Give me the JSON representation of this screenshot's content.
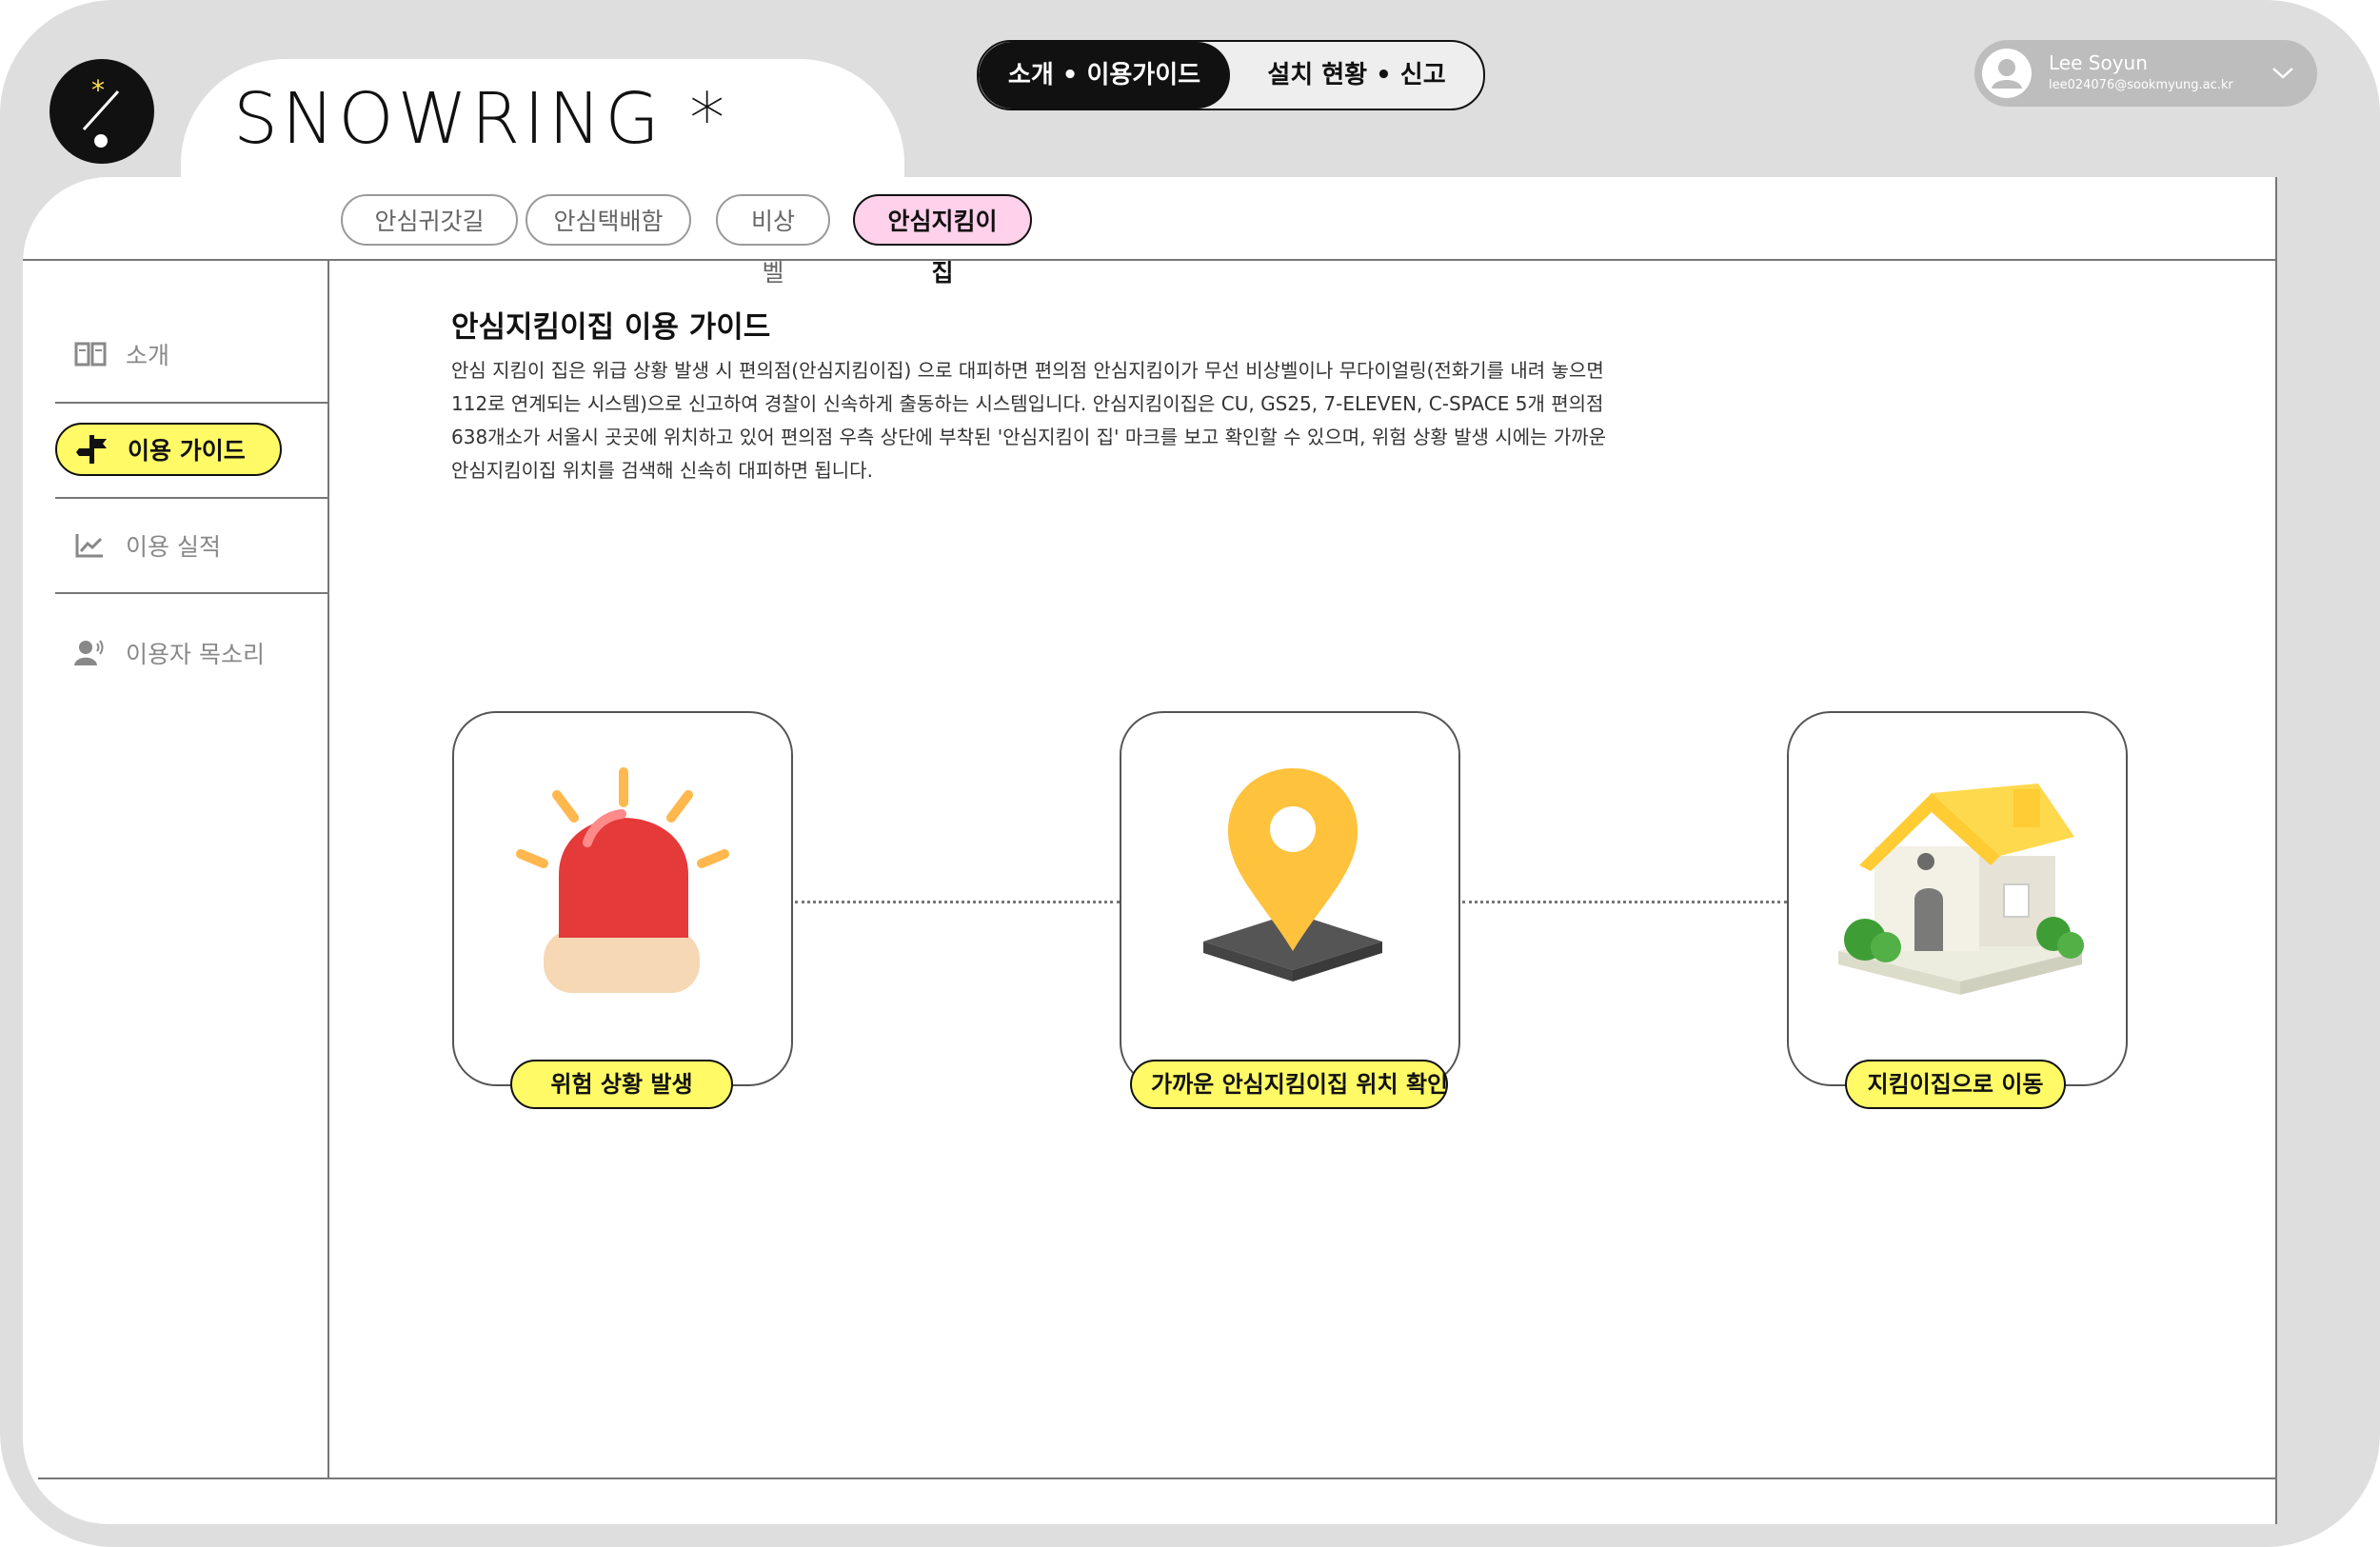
{
  "brand": {
    "wordmark": "SNOWRING *"
  },
  "topnav": {
    "active": "소개 • 이용가이드",
    "inactive": "설치 현황 • 신고"
  },
  "user": {
    "name": "Lee Soyun",
    "email": "lee024076@sookmyung.ac.kr"
  },
  "service_tabs": [
    {
      "label": "안심귀갓길",
      "active": false
    },
    {
      "label": "안심택배함",
      "active": false
    },
    {
      "label": "비상벨",
      "active": false
    },
    {
      "label": "안심지킴이집",
      "active": true
    }
  ],
  "sidebar": {
    "items": [
      {
        "label": "소개",
        "icon": "book-icon",
        "active": false
      },
      {
        "label": "이용 가이드",
        "icon": "signpost-icon",
        "active": true
      },
      {
        "label": "이용 실적",
        "icon": "chart-icon",
        "active": false
      },
      {
        "label": "이용자 목소리",
        "icon": "voice-icon",
        "active": false
      }
    ]
  },
  "main": {
    "title": "안심지킴이집 이용 가이드",
    "description": "안심 지킴이 집은 위급 상황 발생 시 편의점(안심지킴이집) 으로 대피하면 편의점 안심지킴이가 무선 비상벨이나 무다이얼링(전화기를 내려 놓으면 112로 연계되는 시스템)으로 신고하여 경찰이 신속하게 출동하는 시스템입니다. 안심지킴이집은 CU, GS25, 7-ELEVEN, C-SPACE 5개 편의점 638개소가 서울시 곳곳에 위치하고 있어 편의점 우측 상단에 부착된 '안심지킴이 집' 마크를 보고 확인할 수 있으며, 위험 상황 발생 시에는 가까운 안심지킴이집 위치를 검색해 신속히 대피하면 됩니다.",
    "steps": [
      {
        "label": "위험 상황 발생",
        "icon": "siren-icon"
      },
      {
        "label": "가까운 안심지킴이집 위치 확인",
        "icon": "location-pin-icon"
      },
      {
        "label": "지킴이집으로 이동",
        "icon": "house-icon"
      }
    ]
  },
  "colors": {
    "highlight": "#fffa66",
    "active_tab": "#ffd1ea",
    "frame": "#dedede"
  }
}
